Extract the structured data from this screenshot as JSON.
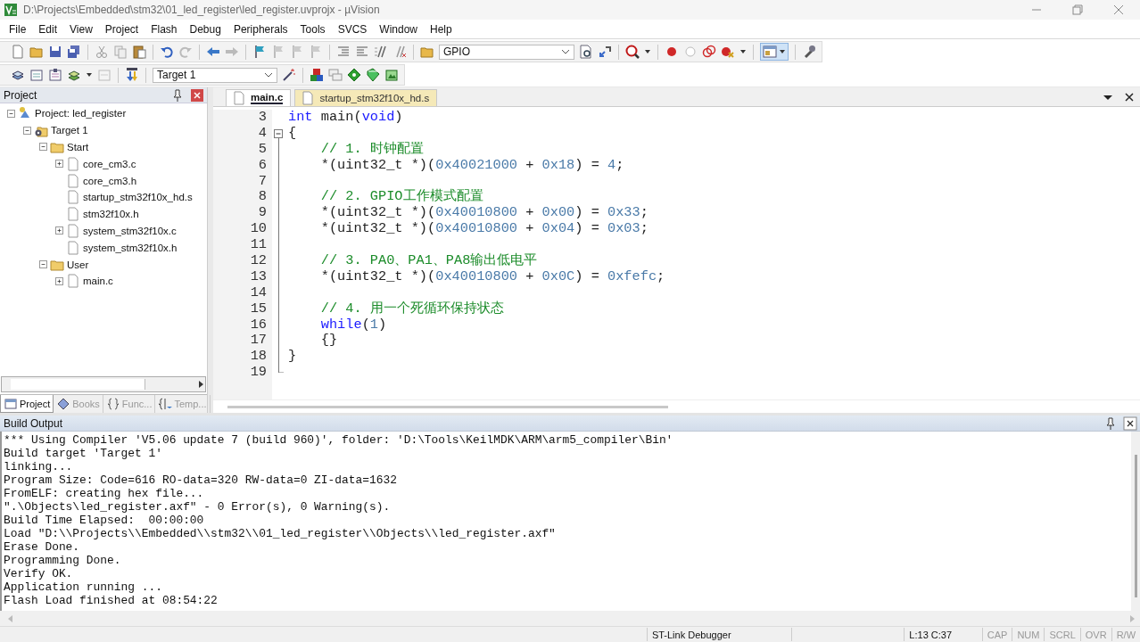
{
  "window": {
    "title": "D:\\Projects\\Embedded\\stm32\\01_led_register\\led_register.uvprojx - µVision"
  },
  "menu": [
    "File",
    "Edit",
    "View",
    "Project",
    "Flash",
    "Debug",
    "Peripherals",
    "Tools",
    "SVCS",
    "Window",
    "Help"
  ],
  "toolbar": {
    "find_combo": {
      "value": "GPIO"
    },
    "target_combo": {
      "value": "Target 1"
    }
  },
  "project_panel": {
    "title": "Project",
    "tree": [
      {
        "kind": "project",
        "label": "Project: led_register",
        "expanded": true,
        "children": [
          {
            "kind": "target",
            "label": "Target 1",
            "expanded": true,
            "children": [
              {
                "kind": "folder",
                "label": "Start",
                "expanded": true,
                "children": [
                  {
                    "kind": "file",
                    "label": "core_cm3.c",
                    "expanded": false
                  },
                  {
                    "kind": "file",
                    "label": "core_cm3.h"
                  },
                  {
                    "kind": "file",
                    "label": "startup_stm32f10x_hd.s"
                  },
                  {
                    "kind": "file",
                    "label": "stm32f10x.h"
                  },
                  {
                    "kind": "file",
                    "label": "system_stm32f10x.c",
                    "expanded": false
                  },
                  {
                    "kind": "file",
                    "label": "system_stm32f10x.h"
                  }
                ]
              },
              {
                "kind": "folder",
                "label": "User",
                "expanded": true,
                "children": [
                  {
                    "kind": "file",
                    "label": "main.c",
                    "expanded": false
                  }
                ]
              }
            ]
          }
        ]
      }
    ],
    "tabs": [
      {
        "kind": "project",
        "label": "Project",
        "selected": true
      },
      {
        "kind": "books",
        "label": "Books",
        "selected": false
      },
      {
        "kind": "functions",
        "label": "Func...",
        "selected": false
      },
      {
        "kind": "templates",
        "label": "Temp...",
        "selected": false
      }
    ]
  },
  "editor": {
    "tabs": [
      {
        "label": "main.c",
        "selected": true
      },
      {
        "label": "startup_stm32f10x_hd.s",
        "selected": false
      }
    ],
    "lines": [
      {
        "number": "3",
        "segments": [
          {
            "kind": "keyword",
            "text": "int"
          },
          {
            "kind": "text",
            "text": " main("
          },
          {
            "kind": "keyword",
            "text": "void"
          },
          {
            "kind": "text",
            "text": ")"
          }
        ]
      },
      {
        "number": "4",
        "fold_expanded": true,
        "segments": [
          {
            "kind": "text",
            "text": "{"
          }
        ]
      },
      {
        "number": "5",
        "segments": [
          {
            "kind": "comment",
            "text": "    // 1. 时钟配置"
          }
        ]
      },
      {
        "number": "6",
        "segments": [
          {
            "kind": "text",
            "text": "    *(uint32_t *)("
          },
          {
            "kind": "number",
            "text": "0x40021000"
          },
          {
            "kind": "text",
            "text": " + "
          },
          {
            "kind": "number",
            "text": "0x18"
          },
          {
            "kind": "text",
            "text": ") = "
          },
          {
            "kind": "number",
            "text": "4"
          },
          {
            "kind": "text",
            "text": ";"
          }
        ]
      },
      {
        "number": "7"
      },
      {
        "number": "8",
        "segments": [
          {
            "kind": "comment",
            "text": "    // 2. GPIO工作模式配置"
          }
        ]
      },
      {
        "number": "9",
        "segments": [
          {
            "kind": "text",
            "text": "    *(uint32_t *)("
          },
          {
            "kind": "number",
            "text": "0x40010800"
          },
          {
            "kind": "text",
            "text": " + "
          },
          {
            "kind": "number",
            "text": "0x00"
          },
          {
            "kind": "text",
            "text": ") = "
          },
          {
            "kind": "number",
            "text": "0x33"
          },
          {
            "kind": "text",
            "text": ";"
          }
        ]
      },
      {
        "number": "10",
        "segments": [
          {
            "kind": "text",
            "text": "    *(uint32_t *)("
          },
          {
            "kind": "number",
            "text": "0x40010800"
          },
          {
            "kind": "text",
            "text": " + "
          },
          {
            "kind": "number",
            "text": "0x04"
          },
          {
            "kind": "text",
            "text": ") = "
          },
          {
            "kind": "number",
            "text": "0x03"
          },
          {
            "kind": "text",
            "text": ";"
          }
        ]
      },
      {
        "number": "11"
      },
      {
        "number": "12",
        "segments": [
          {
            "kind": "comment",
            "text": "    // 3. PA0、PA1、PA8输出低电平"
          }
        ]
      },
      {
        "number": "13",
        "segments": [
          {
            "kind": "text",
            "text": "    *(uint32_t *)("
          },
          {
            "kind": "number",
            "text": "0x40010800"
          },
          {
            "kind": "text",
            "text": " + "
          },
          {
            "kind": "number",
            "text": "0x0C"
          },
          {
            "kind": "text",
            "text": ") = "
          },
          {
            "kind": "number",
            "text": "0xfefc"
          },
          {
            "kind": "text",
            "text": ";"
          }
        ]
      },
      {
        "number": "14"
      },
      {
        "number": "15",
        "segments": [
          {
            "kind": "comment",
            "text": "    // 4. 用一个死循环保持状态"
          }
        ]
      },
      {
        "number": "16",
        "segments": [
          {
            "kind": "keyword",
            "text": "    while"
          },
          {
            "kind": "text",
            "text": "("
          },
          {
            "kind": "number",
            "text": "1"
          },
          {
            "kind": "text",
            "text": ")"
          }
        ]
      },
      {
        "number": "17",
        "segments": [
          {
            "kind": "text",
            "text": "    {}"
          }
        ]
      },
      {
        "number": "18",
        "segments": [
          {
            "kind": "text",
            "text": "}"
          }
        ]
      },
      {
        "number": "19"
      }
    ]
  },
  "build_output": {
    "title": "Build Output",
    "lines": [
      "*** Using Compiler 'V5.06 update 7 (build 960)', folder: 'D:\\Tools\\KeilMDK\\ARM\\arm5_compiler\\Bin'",
      "Build target 'Target 1'",
      "linking...",
      "Program Size: Code=616 RO-data=320 RW-data=0 ZI-data=1632",
      "FromELF: creating hex file...",
      "\".\\Objects\\led_register.axf\" - 0 Error(s), 0 Warning(s).",
      "Build Time Elapsed:  00:00:00",
      "Load \"D:\\\\Projects\\\\Embedded\\\\stm32\\\\01_led_register\\\\Objects\\\\led_register.axf\"",
      "Erase Done.",
      "Programming Done.",
      "Verify OK.",
      "Application running ...",
      "Flash Load finished at 08:54:22"
    ]
  },
  "status_bar": {
    "debugger": "ST-Link Debugger",
    "position": "L:13 C:37",
    "indicators": [
      {
        "label": "CAP",
        "on": false
      },
      {
        "label": "NUM",
        "on": false
      },
      {
        "label": "SCRL",
        "on": false
      },
      {
        "label": "OVR",
        "on": false
      },
      {
        "label": "R/W",
        "on": false
      }
    ]
  }
}
